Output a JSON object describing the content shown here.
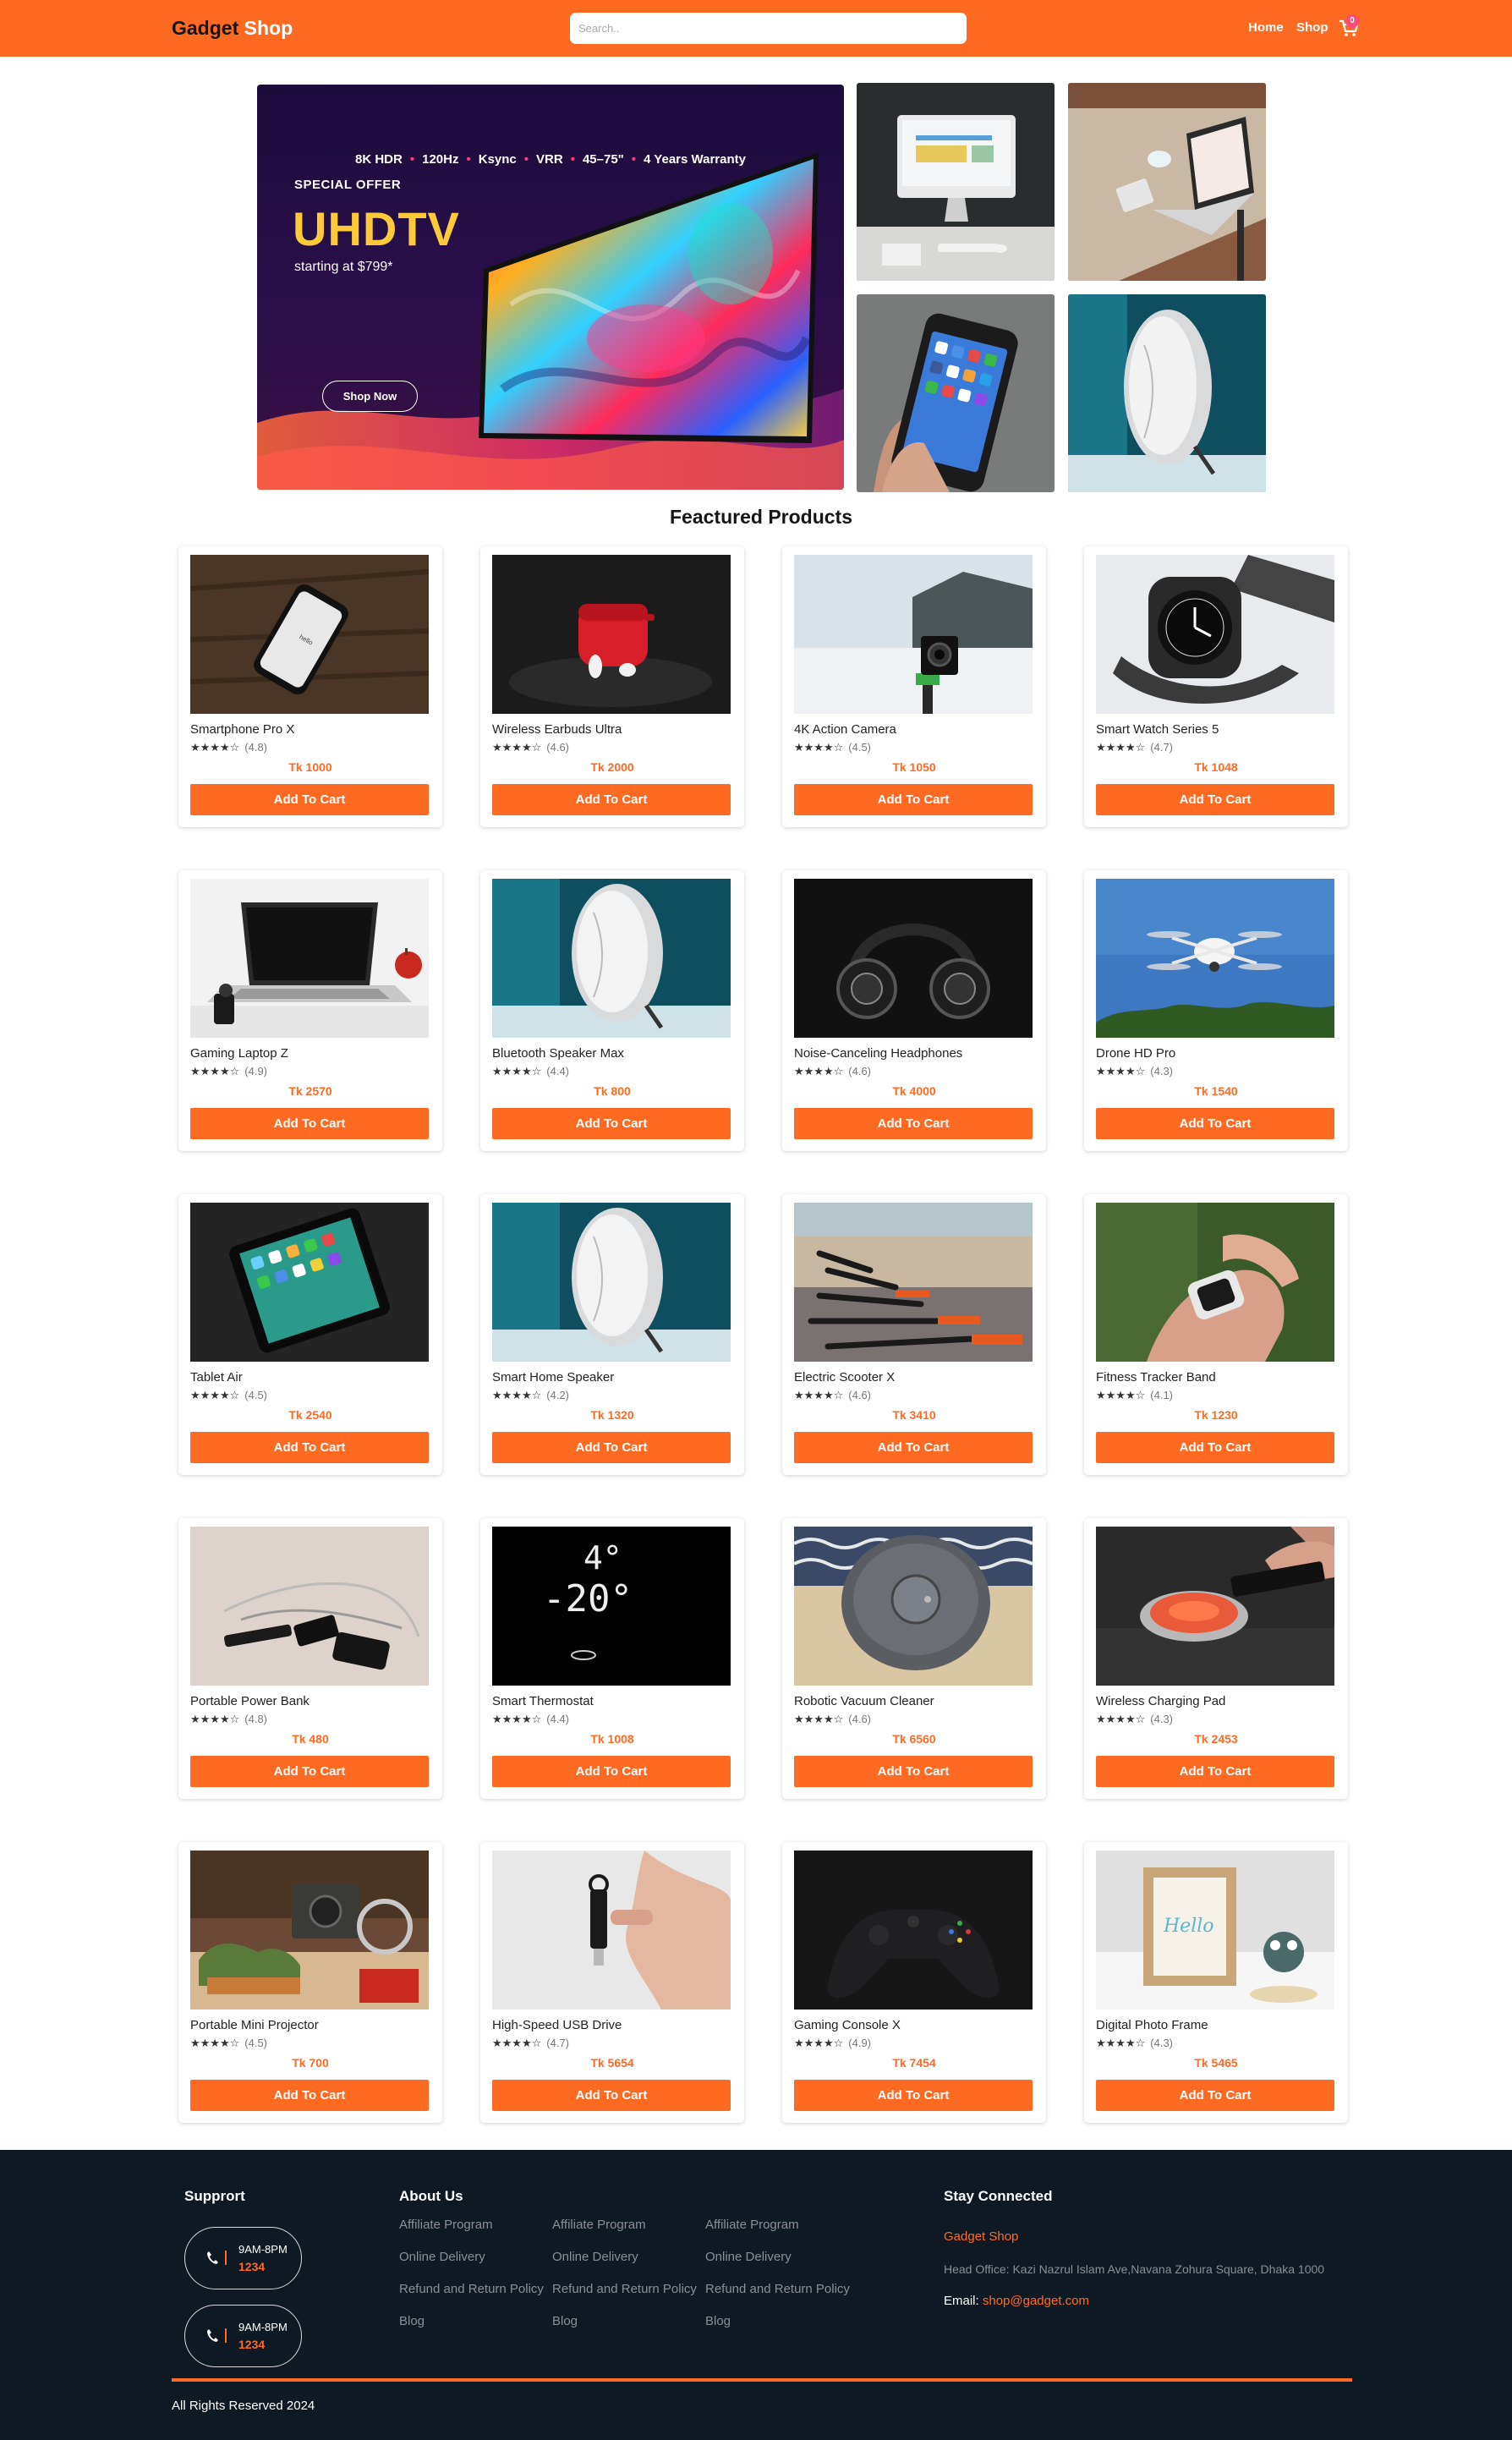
{
  "header": {
    "brand_part1": "Gadget",
    "brand_part2": "Shop",
    "search_placeholder": "Search..",
    "nav": [
      "Home",
      "Shop"
    ],
    "cart_count": "0",
    "accent": "#ff6a23"
  },
  "hero": {
    "features": [
      "8K HDR",
      "120Hz",
      "Ksync",
      "VRR",
      "45–75\"",
      "4 Years Warranty"
    ],
    "tag": "SPECIAL OFFER",
    "title": "UHDTV",
    "subtitle": "starting at $799*",
    "button": "Shop Now"
  },
  "tiles": [
    {
      "icon": "desktop-computer-image"
    },
    {
      "icon": "laptop-on-desk-image"
    },
    {
      "icon": "smartphone-in-hand-image"
    },
    {
      "icon": "speaker-image"
    }
  ],
  "section_title": "Feactured Products",
  "products": [
    {
      "name": "Smartphone Pro X",
      "stars": "★★★★☆",
      "rating": "(4.8)",
      "price": "Tk 1000",
      "button": "Add To Cart",
      "image": "smartphone"
    },
    {
      "name": "Wireless Earbuds Ultra",
      "stars": "★★★★☆",
      "rating": "(4.6)",
      "price": "Tk 2000",
      "button": "Add To Cart",
      "image": "earbuds"
    },
    {
      "name": "4K Action Camera",
      "stars": "★★★★☆",
      "rating": "(4.5)",
      "price": "Tk 1050",
      "button": "Add To Cart",
      "image": "camera"
    },
    {
      "name": "Smart Watch Series 5",
      "stars": "★★★★☆",
      "rating": "(4.7)",
      "price": "Tk 1048",
      "button": "Add To Cart",
      "image": "watch"
    },
    {
      "name": "Gaming Laptop Z",
      "stars": "★★★★☆",
      "rating": "(4.9)",
      "price": "Tk 2570",
      "button": "Add To Cart",
      "image": "laptop"
    },
    {
      "name": "Bluetooth Speaker Max",
      "stars": "★★★★☆",
      "rating": "(4.4)",
      "price": "Tk 800",
      "button": "Add To Cart",
      "image": "speaker"
    },
    {
      "name": "Noise-Canceling Headphones",
      "stars": "★★★★☆",
      "rating": "(4.6)",
      "price": "Tk 4000",
      "button": "Add To Cart",
      "image": "headphones"
    },
    {
      "name": "Drone HD Pro",
      "stars": "★★★★☆",
      "rating": "(4.3)",
      "price": "Tk 1540",
      "button": "Add To Cart",
      "image": "drone"
    },
    {
      "name": "Tablet Air",
      "stars": "★★★★☆",
      "rating": "(4.5)",
      "price": "Tk 2540",
      "button": "Add To Cart",
      "image": "tablet"
    },
    {
      "name": "Smart Home Speaker",
      "stars": "★★★★☆",
      "rating": "(4.2)",
      "price": "Tk 1320",
      "button": "Add To Cart",
      "image": "speaker"
    },
    {
      "name": "Electric Scooter X",
      "stars": "★★★★☆",
      "rating": "(4.6)",
      "price": "Tk 3410",
      "button": "Add To Cart",
      "image": "scooter"
    },
    {
      "name": "Fitness Tracker Band",
      "stars": "★★★★☆",
      "rating": "(4.1)",
      "price": "Tk 1230",
      "button": "Add To Cart",
      "image": "tracker"
    },
    {
      "name": "Portable Power Bank",
      "stars": "★★★★☆",
      "rating": "(4.8)",
      "price": "Tk 480",
      "button": "Add To Cart",
      "image": "powerbank"
    },
    {
      "name": "Smart Thermostat",
      "stars": "★★★★☆",
      "rating": "(4.4)",
      "price": "Tk 1008",
      "button": "Add To Cart",
      "image": "thermostat"
    },
    {
      "name": "Robotic Vacuum Cleaner",
      "stars": "★★★★☆",
      "rating": "(4.6)",
      "price": "Tk 6560",
      "button": "Add To Cart",
      "image": "vacuum"
    },
    {
      "name": "Wireless Charging Pad",
      "stars": "★★★★☆",
      "rating": "(4.3)",
      "price": "Tk 2453",
      "button": "Add To Cart",
      "image": "charger"
    },
    {
      "name": "Portable Mini Projector",
      "stars": "★★★★☆",
      "rating": "(4.5)",
      "price": "Tk 700",
      "button": "Add To Cart",
      "image": "projector"
    },
    {
      "name": "High-Speed USB Drive",
      "stars": "★★★★☆",
      "rating": "(4.7)",
      "price": "Tk 5654",
      "button": "Add To Cart",
      "image": "usb"
    },
    {
      "name": "Gaming Console X",
      "stars": "★★★★☆",
      "rating": "(4.9)",
      "price": "Tk 7454",
      "button": "Add To Cart",
      "image": "console"
    },
    {
      "name": "Digital Photo Frame",
      "stars": "★★★★☆",
      "rating": "(4.3)",
      "price": "Tk 5465",
      "button": "Add To Cart",
      "image": "frame"
    }
  ],
  "footer": {
    "support_title": "Supprort",
    "support": [
      {
        "hours": "9AM-8PM",
        "number": "1234"
      },
      {
        "hours": "9AM-8PM",
        "number": "1234"
      }
    ],
    "about_title": "About Us",
    "about_columns": [
      [
        "Affiliate Program",
        "Online Delivery",
        "Refund and Return Policy",
        "Blog"
      ],
      [
        "Affiliate Program",
        "Online Delivery",
        "Refund and Return Policy",
        "Blog"
      ],
      [
        "Affiliate Program",
        "Online Delivery",
        "Refund and Return Policy",
        "Blog"
      ]
    ],
    "connected_title": "Stay Connected",
    "brand": "Gadget Shop",
    "address": "Head Office: Kazi Nazrul Islam Ave,Navana Zohura Square, Dhaka 1000",
    "email_label": "Email:",
    "email": "shop@gadget.com",
    "copyright": "All Rights Reserved 2024"
  }
}
